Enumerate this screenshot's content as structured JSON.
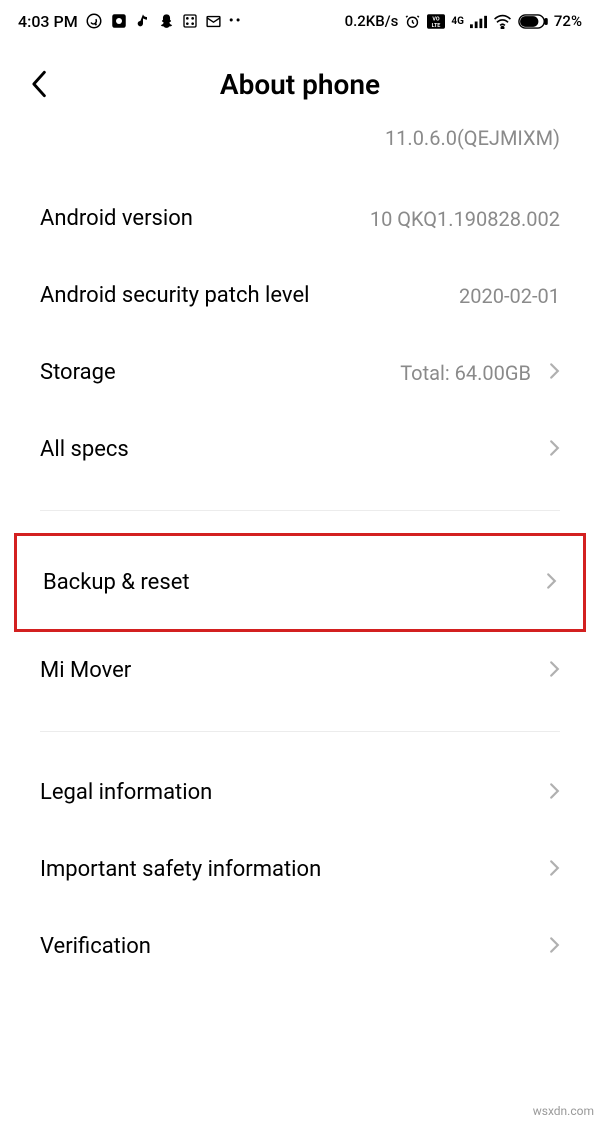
{
  "statusBar": {
    "time": "4:03 PM",
    "dataRate": "0.2KB/s",
    "battery": "72%"
  },
  "header": {
    "title": "About phone"
  },
  "partialVersion": "11.0.6.0(QEJMIXM)",
  "rows": {
    "androidVersion": {
      "label": "Android version",
      "value": "10 QKQ1.190828.002"
    },
    "securityPatch": {
      "label": "Android security patch level",
      "value": "2020-02-01"
    },
    "storage": {
      "label": "Storage",
      "value": "Total: 64.00GB"
    },
    "allSpecs": {
      "label": "All specs"
    },
    "backupReset": {
      "label": "Backup & reset"
    },
    "miMover": {
      "label": "Mi Mover"
    },
    "legal": {
      "label": "Legal information"
    },
    "safety": {
      "label": "Important safety information"
    },
    "verification": {
      "label": "Verification"
    }
  },
  "watermark": "wsxdn.com"
}
